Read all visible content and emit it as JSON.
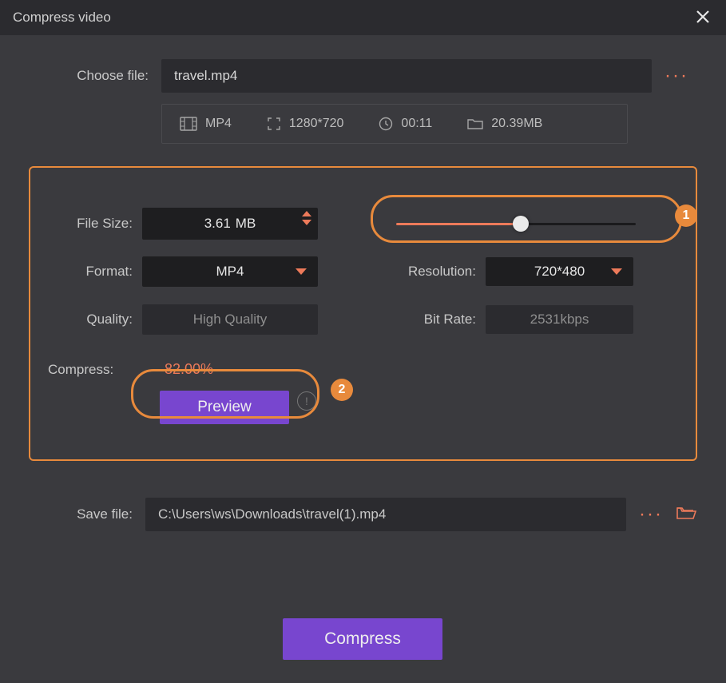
{
  "window": {
    "title": "Compress video"
  },
  "choose": {
    "label": "Choose file:",
    "value": "travel.mp4",
    "info": {
      "format": "MP4",
      "dimensions": "1280*720",
      "duration": "00:11",
      "size": "20.39MB"
    }
  },
  "settings": {
    "file_size": {
      "label": "File Size:",
      "value": "3.61",
      "unit": "MB"
    },
    "format": {
      "label": "Format:",
      "value": "MP4"
    },
    "quality": {
      "label": "Quality:",
      "value": "High Quality"
    },
    "resolution": {
      "label": "Resolution:",
      "value": "720*480"
    },
    "bitrate": {
      "label": "Bit Rate:",
      "value": "2531kbps"
    },
    "slider": {
      "percent": 52
    }
  },
  "compress": {
    "label": "Compress:",
    "value": "-82.00%"
  },
  "preview": {
    "label": "Preview"
  },
  "badges": {
    "one": "1",
    "two": "2"
  },
  "save": {
    "label": "Save file:",
    "value": "C:\\Users\\ws\\Downloads\\travel(1).mp4"
  },
  "action": {
    "compress": "Compress"
  }
}
